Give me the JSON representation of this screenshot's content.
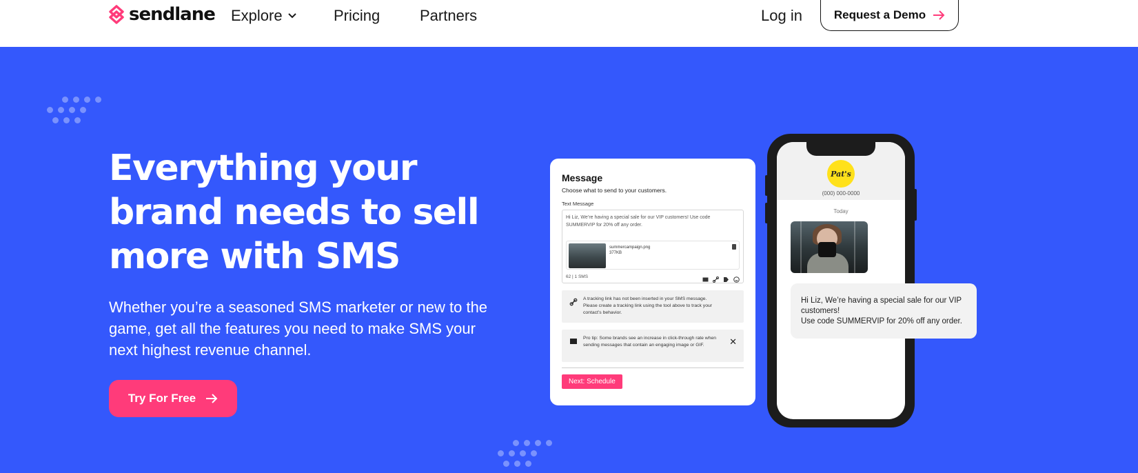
{
  "nav": {
    "logo_text": "sendlane",
    "explore": "Explore",
    "pricing": "Pricing",
    "partners": "Partners",
    "login": "Log in",
    "demo": "Request a Demo"
  },
  "hero": {
    "headline": "Everything your brand needs to sell more with SMS",
    "subtext": "Whether you’re a seasoned SMS marketer or new to the game, get all the features you need to make SMS your next highest revenue channel.",
    "cta": "Try For Free"
  },
  "card": {
    "title": "Message",
    "subtitle": "Choose what to send to your customers.",
    "field_label": "Text Message",
    "message_text": "Hi Liz, We’re having a special sale for our VIP customers! Use code SUMMERVIP for 20% off any order.",
    "attachment_name": "summercampaign.png",
    "attachment_size": "377KB",
    "counter": "62 | 1 SMS",
    "notice_link": "A tracking link has not been inserted in your SMS message. Please create a tracking link using the tool above to track your contact’s behavior.",
    "notice_tip": "Pro tip: Some brands see an increase in click-through rate when sending messages that contain an engaging image or GIF.",
    "next_button": "Next: Schedule"
  },
  "phone": {
    "brand_logo": "Pat's",
    "phone_number": "(000) 000-0000",
    "day_label": "Today",
    "bubble_line1": "Hi Liz, We’re having a special sale for our VIP customers!",
    "bubble_line2": "Use code SUMMERVIP for 20% off any order."
  },
  "colors": {
    "hero_bg": "#3458fc",
    "accent": "#ff3b7a",
    "phone_logo": "#ffe11b"
  }
}
